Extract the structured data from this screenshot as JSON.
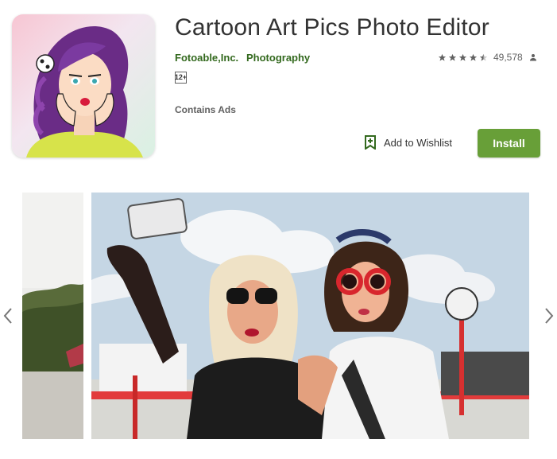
{
  "app": {
    "title": "Cartoon Art Pics Photo Editor",
    "developer": "Fotoable,Inc.",
    "category": "Photography",
    "rating_stars": 4,
    "rating_max": 5,
    "rating_count": "49,578",
    "content_rating": "12+",
    "ads_notice": "Contains Ads"
  },
  "actions": {
    "wishlist_label": "Add to Wishlist",
    "install_label": "Install"
  },
  "icons": {
    "app_icon": "cartoon-woman-icon",
    "star": "star-icon",
    "rating_user": "person-icon",
    "wishlist": "bookmark-add-icon",
    "prev": "chevron-left-icon",
    "next": "chevron-right-icon"
  },
  "colors": {
    "accent_green": "#33691e",
    "install_green": "#689f38",
    "star_filled": "#616161",
    "star_empty": "#c5c5c5"
  }
}
